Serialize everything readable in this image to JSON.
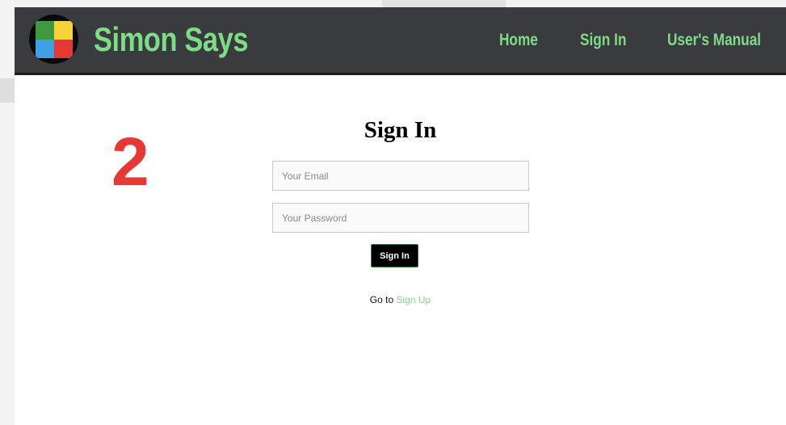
{
  "theme": {
    "accent": "#7ddc86",
    "navbar_bg": "#3a3b3e",
    "step_color": "#e53935",
    "logo_colors": [
      "#3f9a3f",
      "#f7d23a",
      "#3fa0e8",
      "#e53935"
    ]
  },
  "header": {
    "brand": "Simon Says",
    "logo_icon": "simon-logo-icon",
    "nav": [
      {
        "label": "Home"
      },
      {
        "label": "Sign In"
      },
      {
        "label": "User's Manual"
      }
    ]
  },
  "annotation": {
    "step_number": "2"
  },
  "form": {
    "title": "Sign In",
    "email_placeholder": "Your Email",
    "password_placeholder": "Your Password",
    "submit_label": "Sign In",
    "footer_prefix": "Go to",
    "footer_link": "Sign Up"
  }
}
